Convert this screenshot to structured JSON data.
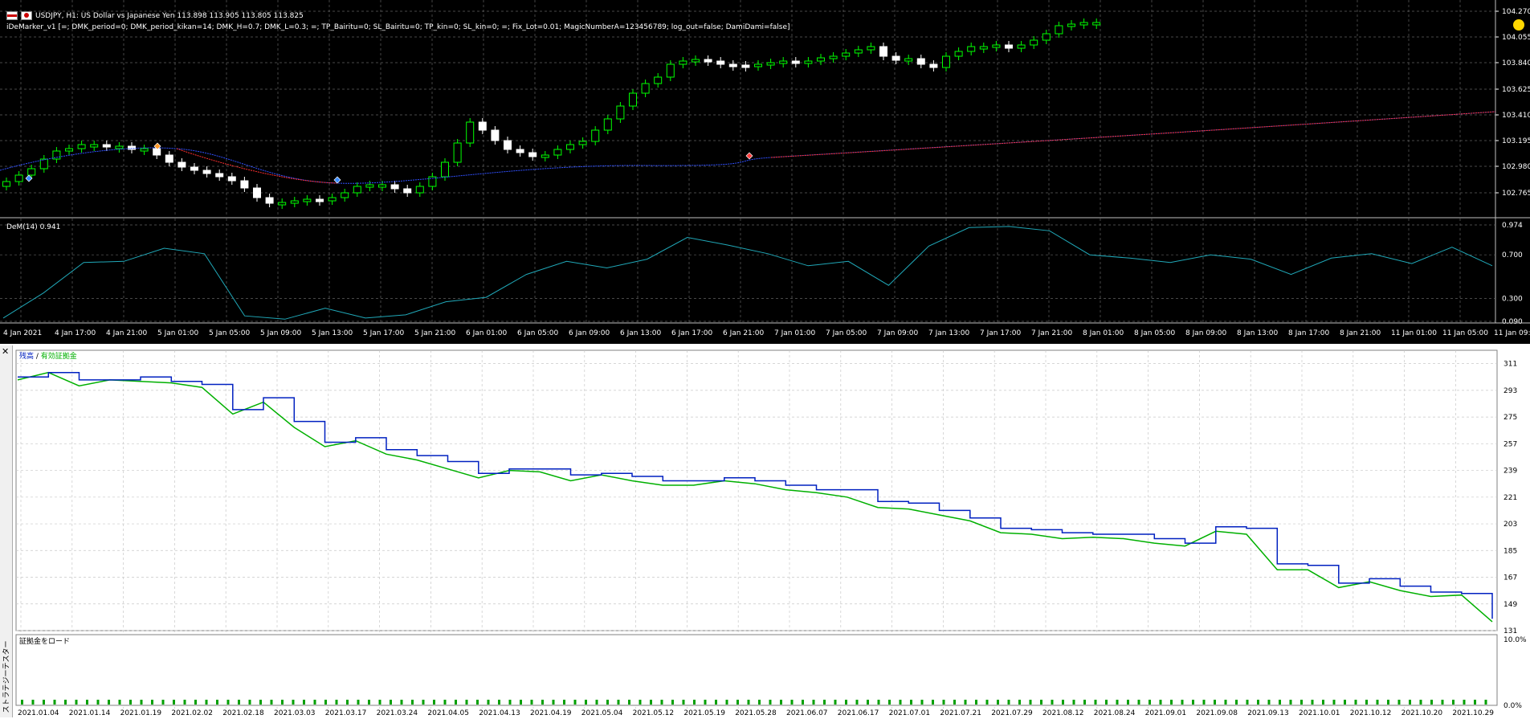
{
  "chart": {
    "symbol_line": "USDJPY, H1:  US Dollar vs Japanese Yen  113.898 113.905 113.805 113.825",
    "ea_line": "iDeMarker_v1 [=; DMK_period=0; DMK_period_kikan=14; DMK_H=0.7; DMK_L=0.3; =; TP_Bairitu=0; SL_Bairitu=0; TP_kin=0; SL_kin=0; =; Fix_Lot=0.01; MagicNumberA=123456789; log_out=false; DamiDami=false]",
    "price_ticks": [
      "104.270",
      "104.055",
      "103.840",
      "103.625",
      "103.410",
      "103.195",
      "102.980",
      "102.765"
    ],
    "time_ticks": [
      "4 Jan 2021",
      "4 Jan 17:00",
      "4 Jan 21:00",
      "5 Jan 01:00",
      "5 Jan 05:00",
      "5 Jan 09:00",
      "5 Jan 13:00",
      "5 Jan 17:00",
      "5 Jan 21:00",
      "6 Jan 01:00",
      "6 Jan 05:00",
      "6 Jan 09:00",
      "6 Jan 13:00",
      "6 Jan 17:00",
      "6 Jan 21:00",
      "7 Jan 01:00",
      "7 Jan 05:00",
      "7 Jan 09:00",
      "7 Jan 13:00",
      "7 Jan 17:00",
      "7 Jan 21:00",
      "8 Jan 01:00",
      "8 Jan 05:00",
      "8 Jan 09:00",
      "8 Jan 13:00",
      "8 Jan 17:00",
      "8 Jan 21:00",
      "11 Jan 01:00",
      "11 Jan 05:00",
      "11 Jan 09:00"
    ],
    "indicator_label": "DeM(14) 0.941",
    "indicator_ticks": [
      "0.974",
      "0.700",
      "0.300",
      "0.090"
    ],
    "colors": {
      "bull": "#00ff00",
      "bear_fill": "#ffffff",
      "ma_down": "#ff3030",
      "ma_up": "#3050ff",
      "dem": "#20a8b8",
      "grid": "#606060"
    }
  },
  "tester": {
    "close_icon": "close-x-icon",
    "side_tab": "ストラテジーテスター",
    "legend_balance": "残高",
    "legend_sep": " / ",
    "legend_equity": "有効証拠金",
    "y_ticks": [
      "311",
      "293",
      "275",
      "257",
      "239",
      "221",
      "203",
      "185",
      "167",
      "149",
      "131"
    ],
    "margin_label": "証拠金をロード",
    "margin_ticks": [
      "10.0%",
      "0.0%"
    ],
    "x_ticks": [
      "2021.01.04",
      "2021.01.14",
      "2021.01.19",
      "2021.02.02",
      "2021.02.18",
      "2021.03.03",
      "2021.03.17",
      "2021.03.24",
      "2021.04.05",
      "2021.04.13",
      "2021.04.19",
      "2021.05.04",
      "2021.05.12",
      "2021.05.19",
      "2021.05.28",
      "2021.06.07",
      "2021.06.17",
      "2021.07.01",
      "2021.07.21",
      "2021.07.29",
      "2021.08.12",
      "2021.08.24",
      "2021.09.01",
      "2021.09.08",
      "2021.09.13",
      "2021.10.01",
      "2021.10.12",
      "2021.10.20",
      "2021.10.29"
    ],
    "colors": {
      "balance": "#0020c0",
      "equity": "#00b000",
      "margin_bar": "#00a000"
    }
  },
  "chart_data": [
    {
      "type": "line",
      "title": "USDJPY, H1",
      "series": [
        {
          "name": "DeM(14)",
          "values": [
            0.12,
            0.35,
            0.63,
            0.64,
            0.76,
            0.71,
            0.14,
            0.11,
            0.21,
            0.12,
            0.15,
            0.27,
            0.31,
            0.52,
            0.64,
            0.58,
            0.66,
            0.86,
            0.79,
            0.71,
            0.6,
            0.64,
            0.42,
            0.78,
            0.95,
            0.96,
            0.92,
            0.7,
            0.67,
            0.63,
            0.7,
            0.66,
            0.52,
            0.67,
            0.71,
            0.62,
            0.77,
            0.6
          ]
        }
      ],
      "ylim": [
        0.09,
        0.974
      ]
    },
    {
      "type": "line",
      "series": [
        {
          "name": "残高",
          "values": [
            302,
            305,
            300,
            300,
            302,
            299,
            297,
            280,
            288,
            272,
            258,
            261,
            253,
            249,
            245,
            237,
            240,
            240,
            236,
            237,
            235,
            232,
            232,
            234,
            232,
            229,
            226,
            226,
            218,
            217,
            212,
            207,
            200,
            199,
            197,
            196,
            196,
            193,
            190,
            201,
            200,
            176,
            175,
            163,
            166,
            161,
            157,
            156,
            139
          ]
        },
        {
          "name": "有効証拠金",
          "values": [
            300,
            305,
            296,
            300,
            299,
            298,
            295,
            277,
            285,
            268,
            255,
            259,
            250,
            246,
            240,
            234,
            239,
            238,
            232,
            236,
            232,
            229,
            229,
            232,
            230,
            226,
            224,
            221,
            214,
            213,
            209,
            205,
            197,
            196,
            193,
            194,
            193,
            190,
            188,
            198,
            196,
            172,
            172,
            160,
            164,
            158,
            154,
            155,
            137
          ]
        }
      ],
      "categories": [
        "2021.01.04",
        "2021.10.29"
      ],
      "ylim": [
        131,
        320
      ]
    }
  ]
}
